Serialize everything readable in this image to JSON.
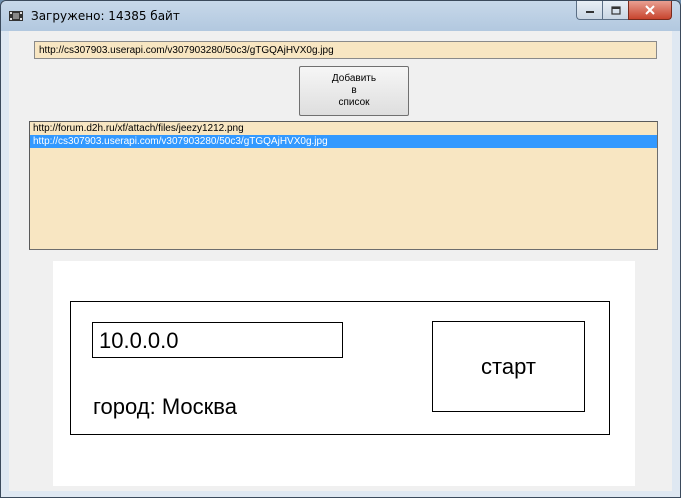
{
  "window": {
    "title": "Загружено: 14385 байт",
    "icons": {
      "app": "film-strip-icon",
      "minimize": "minimize-icon",
      "maximize": "maximize-icon",
      "close": "close-icon"
    }
  },
  "url_field": {
    "value": "http://cs307903.userapi.com/v307903280/50c3/gTGQAjHVX0g.jpg"
  },
  "add_button": {
    "line1": "Добавить",
    "line2": "в",
    "line3": "список"
  },
  "list": {
    "items": [
      {
        "text": "http://forum.d2h.ru/xf/attach/files/jeezy1212.png",
        "selected": false
      },
      {
        "text": "http://cs307903.userapi.com/v307903280/50c3/gTGQAjHVX0g.jpg",
        "selected": true
      }
    ]
  },
  "preview": {
    "ip_value": "10.0.0.0",
    "start_label": "старт",
    "city_label": "город:",
    "city_value": "Москва"
  }
}
